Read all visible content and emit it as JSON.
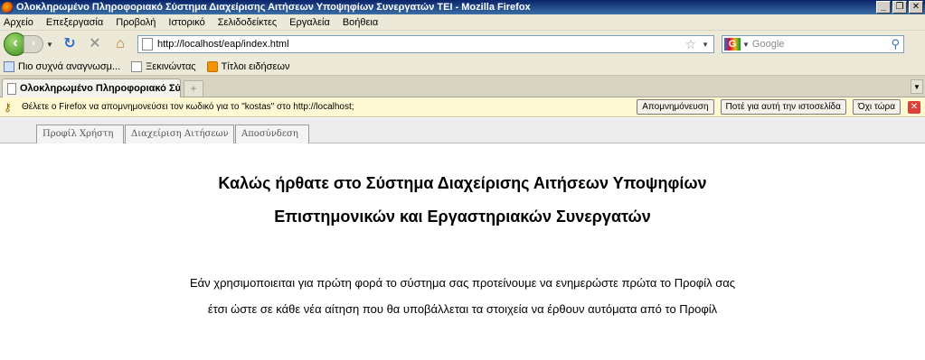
{
  "window": {
    "title": "Ολοκληρωμένο Πληροφοριακό Σύστημα Διαχείρισης Αιτήσεων Υποψηφίων Συνεργατών ΤΕΙ - Mozilla Firefox",
    "minimize": "_",
    "maximize": "❐",
    "close": "✕"
  },
  "menu": [
    "Αρχείο",
    "Επεξεργασία",
    "Προβολή",
    "Ιστορικό",
    "Σελιδοδείκτες",
    "Εργαλεία",
    "Βοήθεια"
  ],
  "nav": {
    "url": "http://localhost/eap/index.html",
    "search_placeholder": "Google"
  },
  "bookmarks": [
    "Πιο συχνά αναγνωσμ...",
    "Ξεκινώντας",
    "Τίτλοι ειδήσεων"
  ],
  "tab": {
    "label": "Ολοκληρωμένο Πληροφοριακό Σύστ...",
    "new_tab": "+"
  },
  "notification": {
    "message": "Θέλετε ο Firefox να απομνημονεύσει τον κωδικό για το \"kostas\" στο http://localhost;",
    "buttons": [
      "Απομνημόνευση",
      "Ποτέ για αυτή την ιστοσελίδα",
      "Όχι τώρα"
    ]
  },
  "app_tabs": [
    "Προφίλ Χρήστη",
    "Διαχείριση Αιτήσεων",
    "Αποσύνδεση"
  ],
  "welcome": {
    "line1": "Καλώς ήρθατε στο Σύστημα Διαχείρισης Αιτήσεων Υποψηφίων",
    "line2": "Επιστημονικών και Εργαστηριακών Συνεργατών"
  },
  "info": {
    "line1": "Εάν χρησιμοποιειται για πρώτη φορά το σύστημα σας προτείνουμε να ενημερώστε πρώτα το Προφίλ σας",
    "line2": "έτσι ώστε σε κάθε νέα αίτηση που θα υποβάλλεται τα στοιχεία να έρθουν αυτόματα από το Προφίλ"
  }
}
